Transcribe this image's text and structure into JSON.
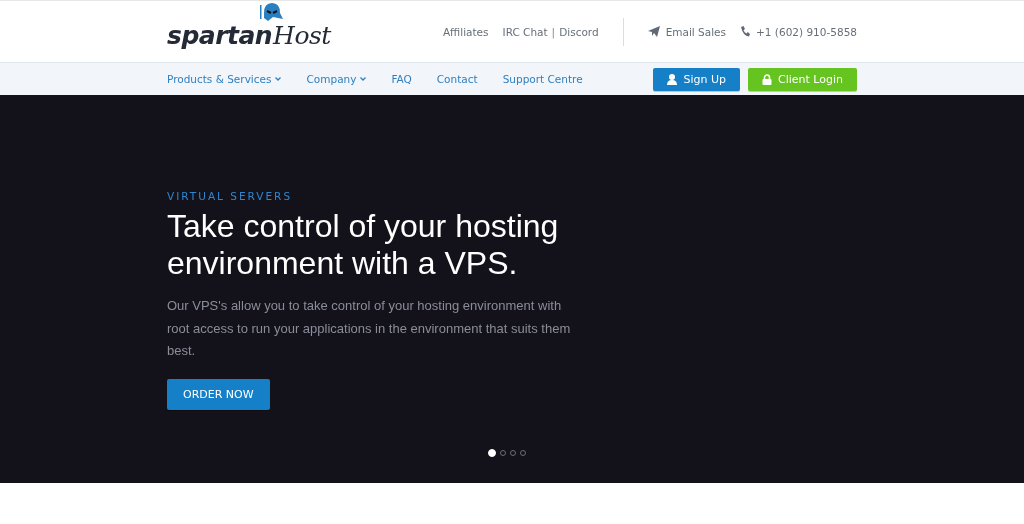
{
  "logo": {
    "text": "spartan",
    "accent": "Host"
  },
  "top_links": [
    "Affiliates",
    "IRC Chat",
    "Discord"
  ],
  "top_link_separator": "|",
  "contacts": [
    {
      "kind": "email",
      "label": "Email Sales"
    },
    {
      "kind": "phone",
      "label": "+1 (602) 910-5858"
    }
  ],
  "nav": [
    {
      "label": "Products & Services",
      "has_menu": true
    },
    {
      "label": "Company",
      "has_menu": true
    },
    {
      "label": "FAQ",
      "has_menu": false
    },
    {
      "label": "Contact",
      "has_menu": false
    },
    {
      "label": "Support Centre",
      "has_menu": false
    }
  ],
  "nav_buttons": [
    {
      "kind": "signup",
      "label": "Sign Up"
    },
    {
      "kind": "login",
      "label": "Client Login"
    }
  ],
  "hero": {
    "eyebrow": "VIRTUAL SERVERS",
    "heading": "Take control of your hosting environment with a VPS.",
    "text": "Our VPS's allow you to take control of your hosting environment with root access to run your applications in the environment that suits them best.",
    "button": "ORDER NOW",
    "slides": [
      {
        "selected": true
      },
      {
        "selected": false
      },
      {
        "selected": false
      },
      {
        "selected": false
      }
    ]
  }
}
